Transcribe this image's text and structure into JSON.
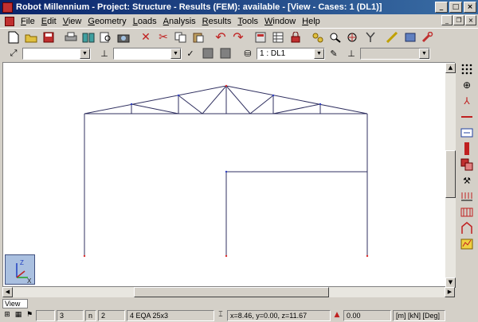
{
  "window": {
    "title": "Robot Millennium - Project: Structure - Results (FEM): available - [View - Cases: 1 (DL1)]"
  },
  "menu": {
    "items": [
      {
        "label": "File",
        "key": "F"
      },
      {
        "label": "Edit",
        "key": "E"
      },
      {
        "label": "View",
        "key": "V"
      },
      {
        "label": "Geometry",
        "key": "G"
      },
      {
        "label": "Loads",
        "key": "L"
      },
      {
        "label": "Analysis",
        "key": "A"
      },
      {
        "label": "Results",
        "key": "R"
      },
      {
        "label": "Tools",
        "key": "T"
      },
      {
        "label": "Window",
        "key": "W"
      },
      {
        "label": "Help",
        "key": "H"
      }
    ]
  },
  "toolbar2": {
    "case_combo": "1 : DL1"
  },
  "tabs": {
    "view": "View"
  },
  "status": {
    "field1": "3",
    "field2_label": "n",
    "field2": "2",
    "section": "4 EQA 25x3",
    "coords": "x=8.46, y=0.00, z=11.67",
    "value": "0.00",
    "units": "[m] [kN] [Deg]"
  },
  "axis": {
    "x": "X",
    "z": "Z"
  },
  "colors": {
    "title_start": "#0a246a",
    "title_end": "#3a6ea5",
    "structure_line": "#303060",
    "node_red": "#e03030",
    "node_blue": "#3040c0"
  }
}
